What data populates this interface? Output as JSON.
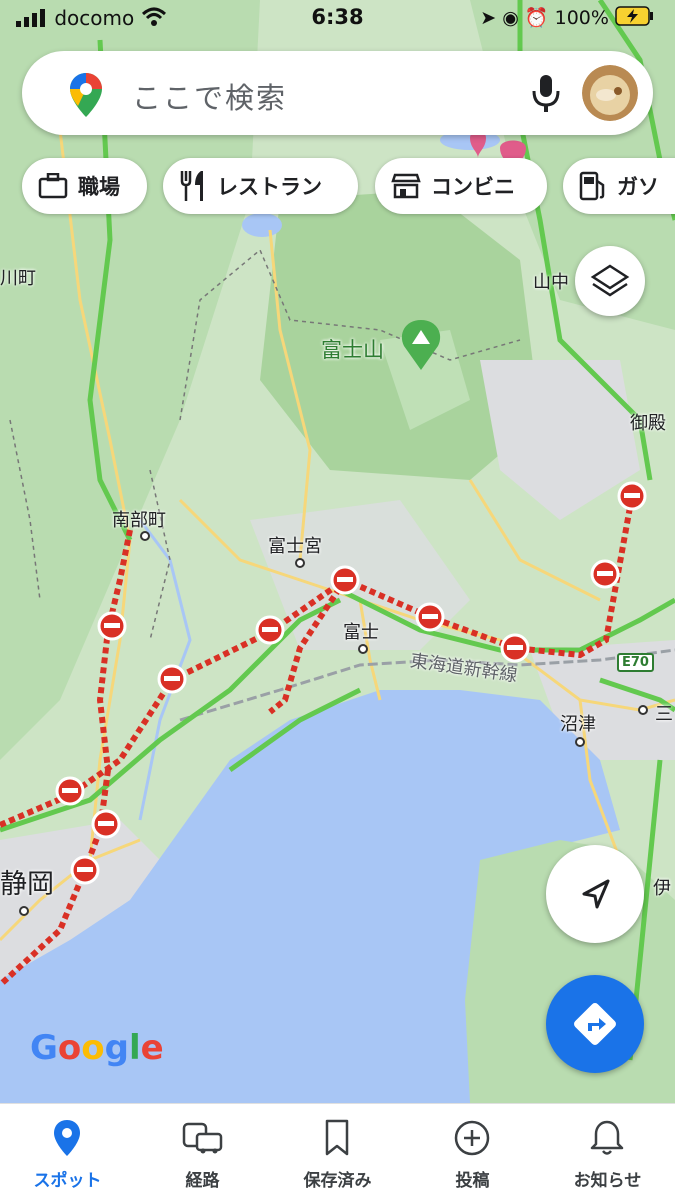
{
  "status_bar": {
    "carrier": "docomo",
    "time": "6:38",
    "battery": "100%"
  },
  "search": {
    "placeholder": "ここで検索"
  },
  "chips": [
    {
      "label": "職場",
      "icon": "briefcase-icon"
    },
    {
      "label": "レストラン",
      "icon": "restaurant-icon"
    },
    {
      "label": "コンビニ",
      "icon": "convenience-store-icon"
    },
    {
      "label": "ガソ",
      "icon": "gas-station-icon"
    }
  ],
  "map_labels": {
    "mt_fuji": "富士山",
    "nanbu": "南部町",
    "fujinomiya": "富士宮",
    "fuji": "富士",
    "shinkansen": "東海道新幹線",
    "numazu": "沼津",
    "shizuoka": "静岡",
    "yamanaka": "山中",
    "gotemba": "御殿",
    "kawa": "川町",
    "e70": "E70",
    "mishima": "三",
    "izu": "伊"
  },
  "attribution": "Google",
  "bottom_nav": [
    {
      "label": "スポット",
      "icon": "location-pin-icon",
      "active": true
    },
    {
      "label": "経路",
      "icon": "car-bus-icon",
      "active": false
    },
    {
      "label": "保存済み",
      "icon": "bookmark-icon",
      "active": false
    },
    {
      "label": "投稿",
      "icon": "add-circle-icon",
      "active": false
    },
    {
      "label": "お知らせ",
      "icon": "bell-icon",
      "active": false
    }
  ],
  "colors": {
    "accent": "#1a73e8",
    "closure": "#d93025",
    "traffic_green": "#63c94f",
    "water": "#a8c6f5",
    "land": "#cfe6c8"
  }
}
